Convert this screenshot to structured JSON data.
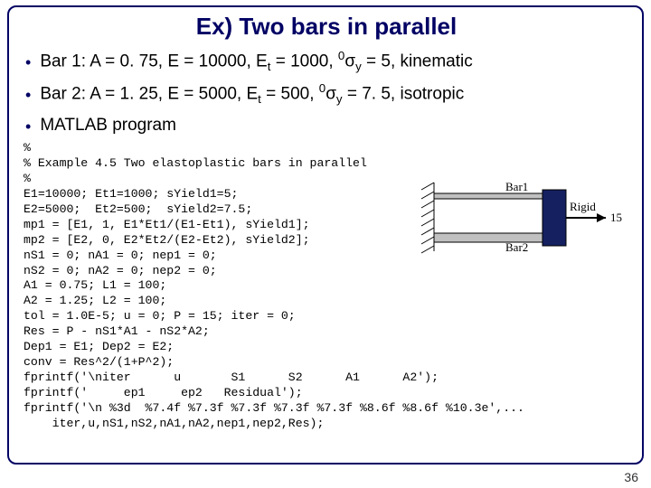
{
  "title": "Ex) Two bars in parallel",
  "bullets": {
    "b1_pre": "Bar 1: A = 0. 75, E = 10000, E",
    "b1_sub1": "t",
    "b1_mid": " = 1000, ",
    "b1_sup": "0",
    "b1_sig": "σ",
    "b1_sub2": "y",
    "b1_post": " = 5, kinematic",
    "b2_pre": "Bar 2: A = 1. 25, E = 5000, E",
    "b2_sub1": "t",
    "b2_mid": " = 500, ",
    "b2_sup": "0",
    "b2_sig": "σ",
    "b2_sub2": "y",
    "b2_post": " = 7. 5, isotropic",
    "b3": "MATLAB program"
  },
  "code": "%\n% Example 4.5 Two elastoplastic bars in parallel\n%\nE1=10000; Et1=1000; sYield1=5;\nE2=5000;  Et2=500;  sYield2=7.5;\nmp1 = [E1, 1, E1*Et1/(E1-Et1), sYield1];\nmp2 = [E2, 0, E2*Et2/(E2-Et2), sYield2];\nnS1 = 0; nA1 = 0; nep1 = 0;\nnS2 = 0; nA2 = 0; nep2 = 0;\nA1 = 0.75; L1 = 100;\nA2 = 1.25; L2 = 100;\ntol = 1.0E-5; u = 0; P = 15; iter = 0;\nRes = P - nS1*A1 - nS2*A2;\nDep1 = E1; Dep2 = E2;\nconv = Res^2/(1+P^2);\nfprintf('\\niter      u       S1      S2      A1      A2');\nfprintf('     ep1     ep2   Residual');\nfprintf('\\n %3d  %7.4f %7.3f %7.3f %7.3f %7.3f %8.6f %8.6f %10.3e',...\n    iter,u,nS1,nS2,nA1,nA2,nep1,nep2,Res);",
  "diagram": {
    "bar1": "Bar1",
    "bar2": "Bar2",
    "rigid": "Rigid",
    "force": "15"
  },
  "slide_number": "36"
}
